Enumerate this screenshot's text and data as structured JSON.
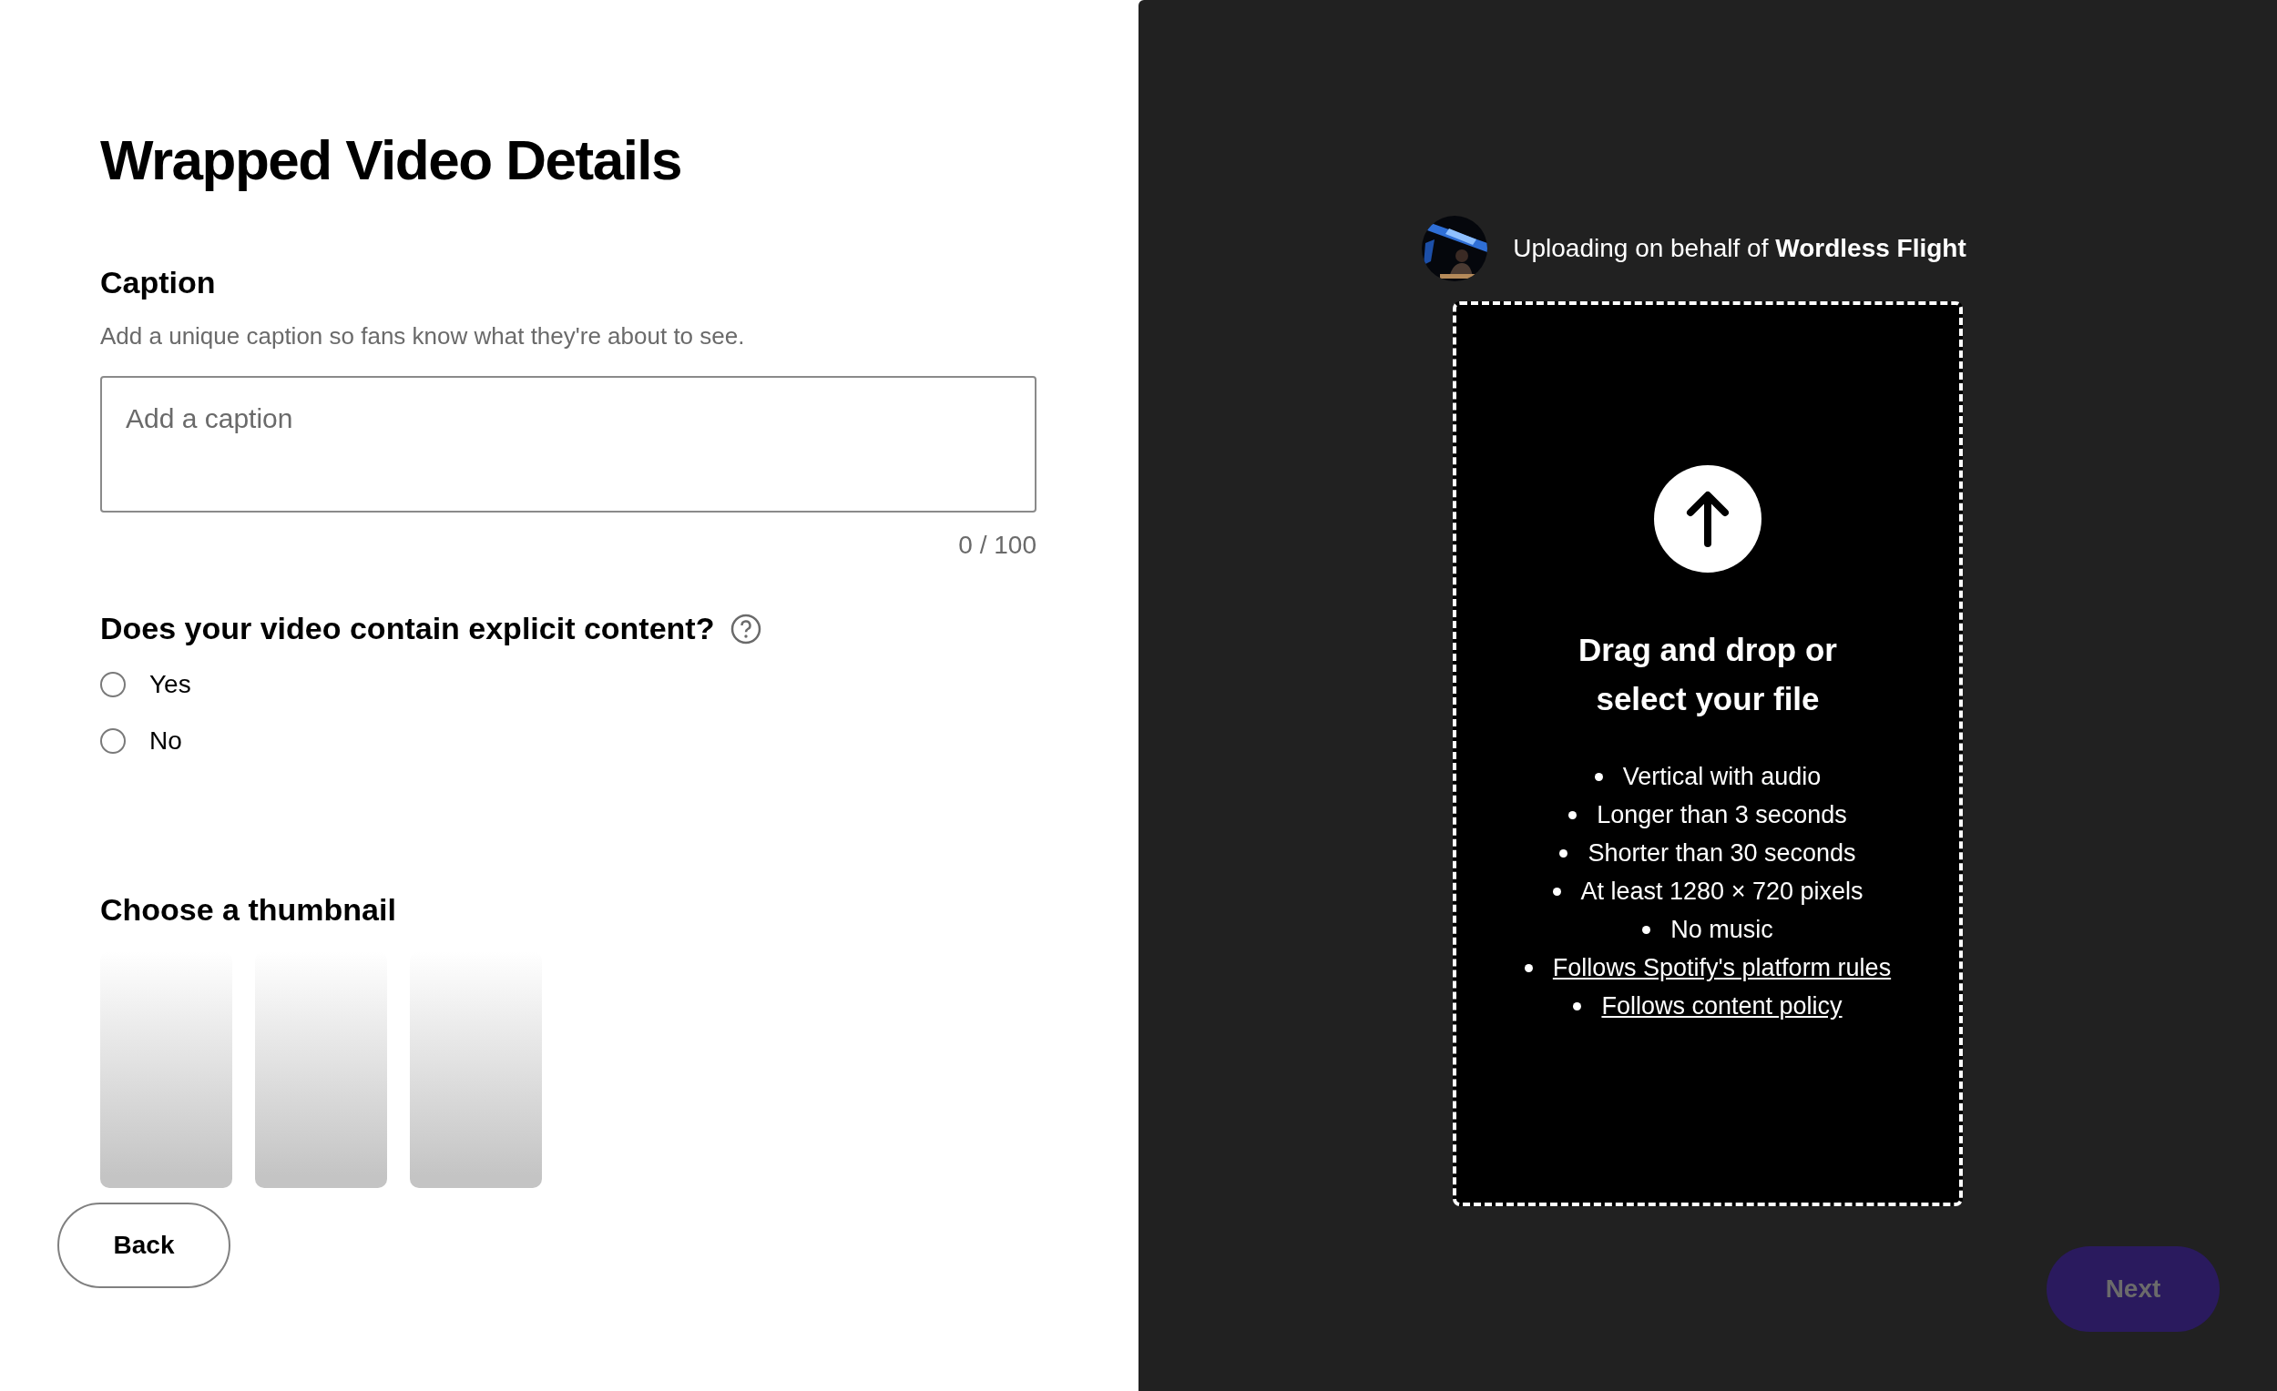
{
  "form": {
    "title": "Wrapped Video Details",
    "caption": {
      "heading": "Caption",
      "description": "Add a unique caption so fans know what they're about to see.",
      "placeholder": "Add a caption",
      "counter": "0 / 100"
    },
    "explicit": {
      "question": "Does your video contain explicit content?",
      "options": [
        {
          "label": "Yes",
          "selected": false
        },
        {
          "label": "No",
          "selected": false
        }
      ]
    },
    "thumbnail": {
      "heading": "Choose a thumbnail",
      "items": [
        {
          "kind": "placeholder"
        },
        {
          "kind": "placeholder"
        },
        {
          "kind": "placeholder"
        }
      ]
    },
    "back_button": "Back"
  },
  "upload": {
    "uploader": "Uploading on behalf of **Wordless Flight**",
    "heading": "Drag and drop or select your file",
    "requirements": [
      {
        "kind": "text",
        "text": "Vertical with audio"
      },
      {
        "kind": "text",
        "text": "Longer than 3 seconds"
      },
      {
        "kind": "text",
        "text": "Shorter than 30 seconds"
      },
      {
        "kind": "text",
        "text": "At least 1280 × 720 pixels"
      },
      {
        "kind": "text",
        "text": "No music"
      },
      {
        "kind": "link",
        "text": "Follows Spotify's platform rules"
      },
      {
        "kind": "link",
        "text": "Follows content policy"
      }
    ],
    "next_button": {
      "label": "Next",
      "disabled": true
    }
  }
}
